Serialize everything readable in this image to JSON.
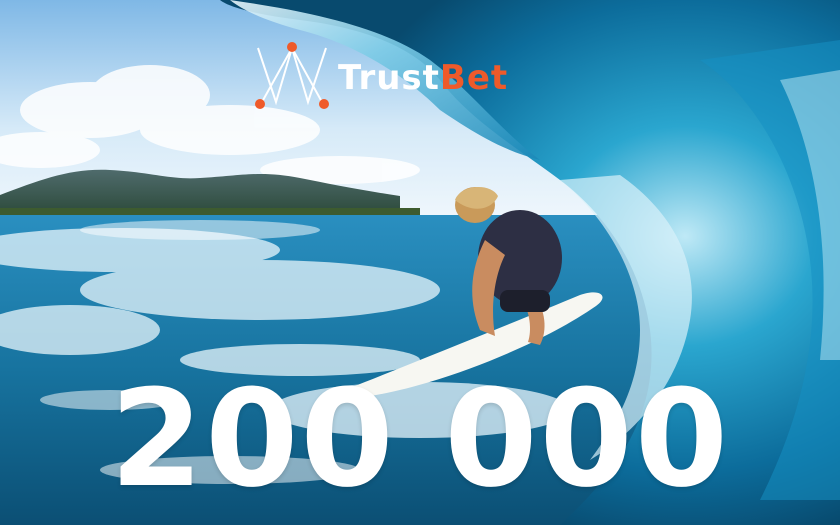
{
  "brand": {
    "name_part1": "Trust",
    "name_part2": "Bet",
    "accent_color": "#ef5a2a",
    "logo_icon": "trustbet-logo-icon"
  },
  "promo": {
    "amount": "200 000"
  },
  "scene": {
    "background": "surf-wave-photo",
    "colors": {
      "sky": "#cfe6f6",
      "ocean": "#1b7fb0",
      "wave": "#0e6f9e",
      "foam": "#f2fbff"
    }
  }
}
